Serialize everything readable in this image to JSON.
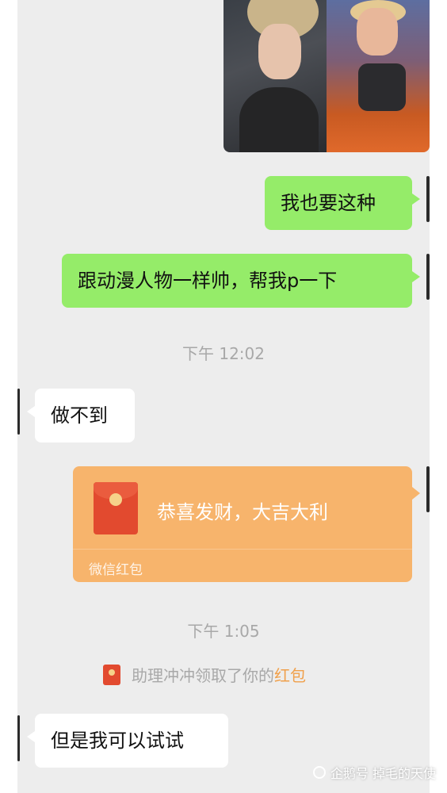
{
  "messages": [
    {
      "type": "image",
      "from": "me"
    },
    {
      "type": "text",
      "from": "me",
      "text": "我也要这种"
    },
    {
      "type": "text",
      "from": "me",
      "text": "跟动漫人物一样帅，帮我p一下"
    },
    {
      "type": "timestamp",
      "text": "下午 12:02"
    },
    {
      "type": "text",
      "from": "other",
      "text": "做不到"
    },
    {
      "type": "redpacket",
      "from": "me",
      "title": "恭喜发财，大吉大利",
      "footer": "微信红包"
    },
    {
      "type": "timestamp",
      "text": "下午 1:05"
    },
    {
      "type": "system",
      "prefix": "助理冲冲领取了你的",
      "link": "红包"
    },
    {
      "type": "text",
      "from": "other",
      "text": "但是我可以试试"
    }
  ],
  "watermark": {
    "text": "企鹅号 掉毛的天使"
  },
  "colors": {
    "sent_bubble": "#95ec69",
    "received_bubble": "#ffffff",
    "chat_background": "#ededed",
    "redpacket": "#f7b46c",
    "redpacket_icon": "#e24a2f",
    "link": "#f0a04b",
    "timestamp": "#a8a8a8"
  },
  "icons": [
    "redpacket-icon",
    "redpacket-small-icon",
    "watermark-logo-icon"
  ]
}
